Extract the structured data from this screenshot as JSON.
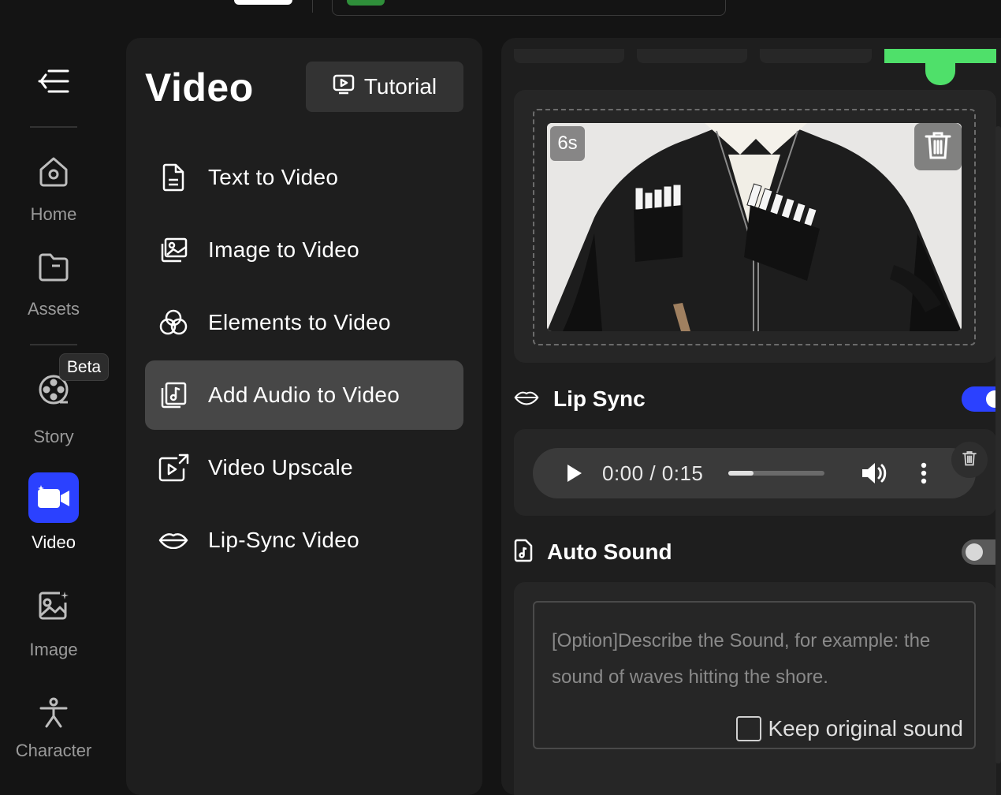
{
  "sidebar": {
    "items": [
      {
        "label": "Home",
        "icon": "home-icon"
      },
      {
        "label": "Assets",
        "icon": "folder-icon"
      },
      {
        "label": "Story",
        "icon": "film-reel-icon",
        "badge": "Beta"
      },
      {
        "label": "Video",
        "icon": "video-camera-icon",
        "active": true
      },
      {
        "label": "Image",
        "icon": "image-icon"
      },
      {
        "label": "Character",
        "icon": "person-icon"
      }
    ]
  },
  "menu": {
    "title": "Video",
    "tutorial_label": "Tutorial",
    "items": [
      {
        "label": "Text to Video",
        "icon": "document-icon"
      },
      {
        "label": "Image to Video",
        "icon": "images-icon"
      },
      {
        "label": "Elements to Video",
        "icon": "elements-icon"
      },
      {
        "label": "Add Audio to Video",
        "icon": "music-file-icon",
        "active": true
      },
      {
        "label": "Video Upscale",
        "icon": "upscale-icon"
      },
      {
        "label": "Lip-Sync Video",
        "icon": "lips-icon"
      }
    ]
  },
  "editor": {
    "video": {
      "duration_badge": "6s"
    },
    "lip_sync": {
      "label": "Lip Sync",
      "enabled": true
    },
    "audio_player": {
      "time": "0:00 / 0:15",
      "progress": 0.26
    },
    "auto_sound": {
      "label": "Auto Sound",
      "enabled": false,
      "placeholder": "[Option]Describe the Sound, for example: the sound of waves hitting the shore.",
      "keep_original_label": "Keep original sound",
      "keep_original_checked": false
    }
  },
  "colors": {
    "accent": "#2b41ff",
    "highlight_green": "#4fe06a",
    "background": "#141414",
    "panel": "#1e1e1e"
  }
}
